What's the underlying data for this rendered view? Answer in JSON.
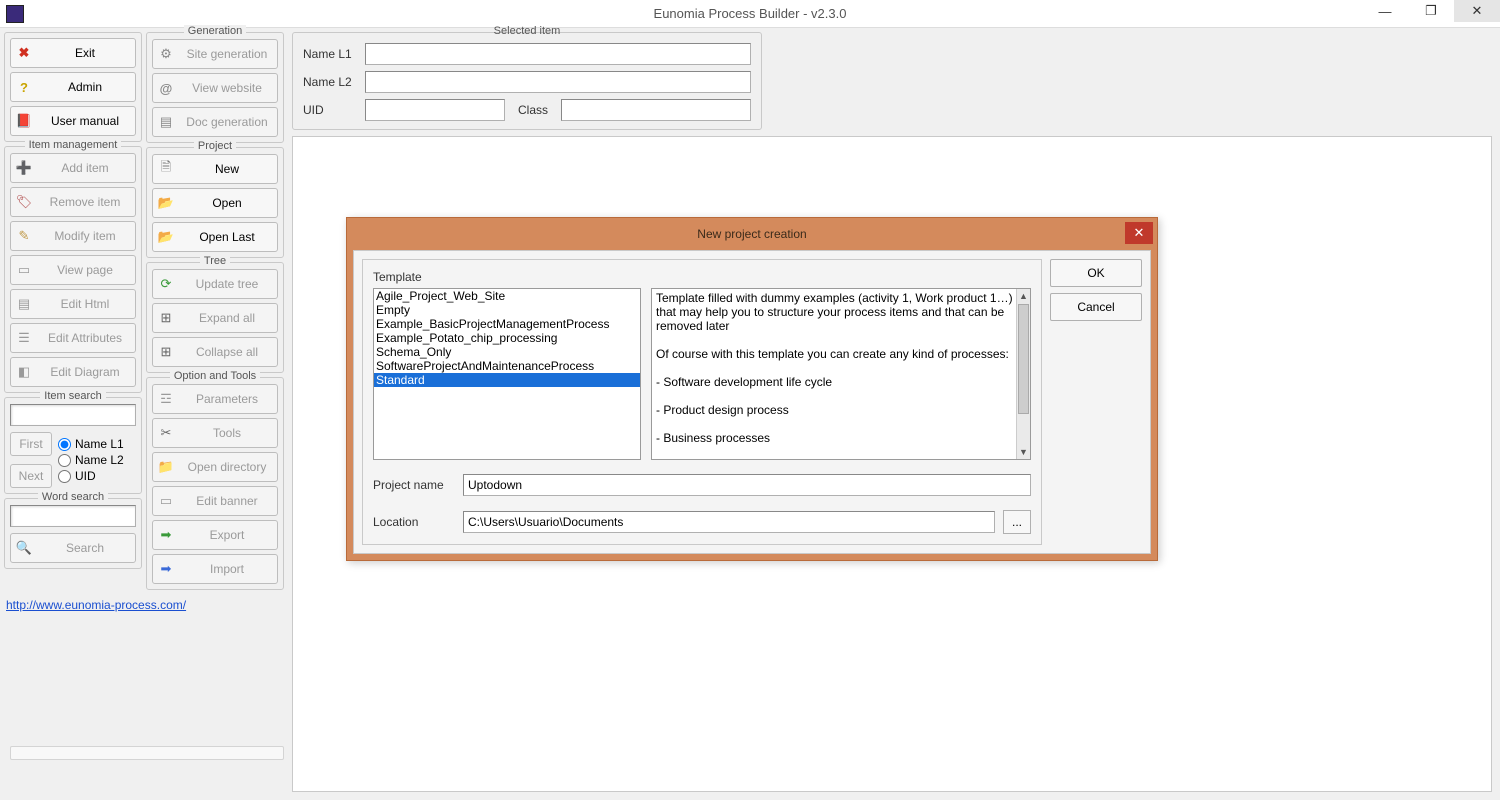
{
  "window": {
    "title": "Eunomia Process Builder - v2.3.0"
  },
  "main_buttons": {
    "exit": "Exit",
    "admin": "Admin",
    "user_manual": "User manual"
  },
  "generation": {
    "title": "Generation",
    "site": "Site generation",
    "view_website": "View website",
    "doc": "Doc generation"
  },
  "item_mgmt": {
    "title": "Item management",
    "add": "Add item",
    "remove": "Remove item",
    "modify": "Modify item",
    "view_page": "View page",
    "edit_html": "Edit Html",
    "edit_attr": "Edit Attributes",
    "edit_diag": "Edit Diagram"
  },
  "project": {
    "title": "Project",
    "new": "New",
    "open": "Open",
    "open_last": "Open Last"
  },
  "tree": {
    "title": "Tree",
    "update": "Update tree",
    "expand": "Expand all",
    "collapse": "Collapse all"
  },
  "item_search": {
    "title": "Item search",
    "first": "First",
    "next": "Next",
    "r1": "Name L1",
    "r2": "Name L2",
    "r3": "UID"
  },
  "word_search": {
    "title": "Word search",
    "search": "Search"
  },
  "options": {
    "title": "Option and Tools",
    "parameters": "Parameters",
    "tools": "Tools",
    "open_dir": "Open directory",
    "edit_banner": "Edit banner",
    "export": "Export",
    "import": "Import"
  },
  "selected": {
    "title": "Selected item",
    "name_l1": "Name L1",
    "name_l2": "Name L2",
    "uid": "UID",
    "class": "Class"
  },
  "link": {
    "url": "http://www.eunomia-process.com/"
  },
  "dialog": {
    "title": "New project creation",
    "ok": "OK",
    "cancel": "Cancel",
    "template_label": "Template",
    "templates": [
      "Agile_Project_Web_Site",
      "Empty",
      "Example_BasicProjectManagementProcess",
      "Example_Potato_chip_processing",
      "Schema_Only",
      "SoftwareProjectAndMaintenanceProcess",
      "Standard"
    ],
    "selected_index": 6,
    "description": "Template filled with dummy examples (activity 1, Work product 1…) that may help you to structure your process items and that can be removed later\n\nOf course with this template you can create any kind of processes:\n\n- Software development life cycle\n\n- Product design process\n\n- Business processes",
    "project_name_label": "Project name",
    "project_name": "Uptodown",
    "location_label": "Location",
    "location": "C:\\Users\\Usuario\\Documents",
    "browse": "..."
  }
}
